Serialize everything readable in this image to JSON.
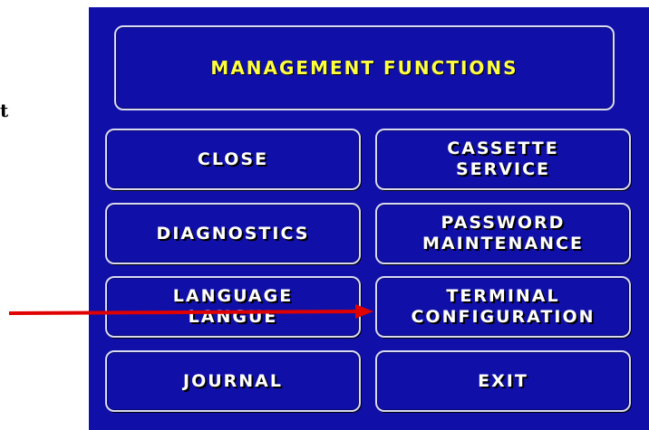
{
  "side_text": "t",
  "header": {
    "title": "MANAGEMENT FUNCTIONS"
  },
  "buttons": {
    "close": {
      "line1": "CLOSE"
    },
    "cassette_service": {
      "line1": "CASSETTE",
      "line2": "SERVICE"
    },
    "diagnostics": {
      "line1": "DIAGNOSTICS"
    },
    "password_maintenance": {
      "line1": "PASSWORD",
      "line2": "MAINTENANCE"
    },
    "language": {
      "line1": "LANGUAGE",
      "line2": "LANGUE"
    },
    "terminal_configuration": {
      "line1": "TERMINAL",
      "line2": "CONFIGURATION"
    },
    "journal": {
      "line1": "JOURNAL"
    },
    "exit": {
      "line1": "EXIT"
    }
  },
  "colors": {
    "screen_background": "#1010a8",
    "title_text": "#ffff40",
    "button_text": "#ffffff",
    "annotation_arrow": "#e00000"
  }
}
